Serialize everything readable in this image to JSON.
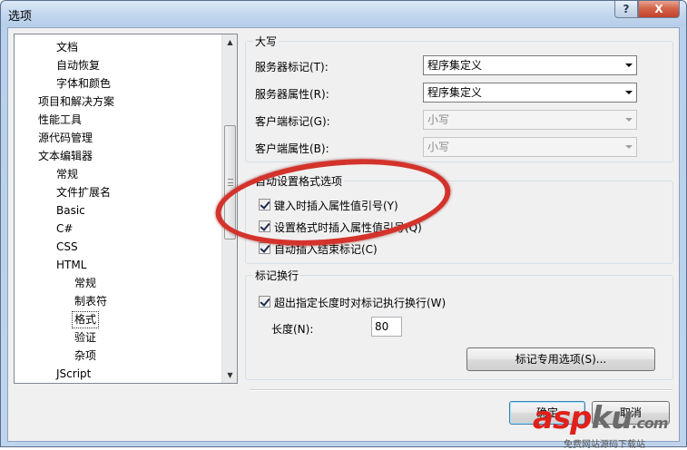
{
  "window": {
    "title": "选项",
    "help_label": "?",
    "close_label": "X"
  },
  "tree": {
    "items": [
      {
        "label": "文档",
        "indent": 1
      },
      {
        "label": "自动恢复",
        "indent": 1
      },
      {
        "label": "字体和颜色",
        "indent": 1
      },
      {
        "label": "项目和解决方案",
        "indent": 0
      },
      {
        "label": "性能工具",
        "indent": 0
      },
      {
        "label": "源代码管理",
        "indent": 0
      },
      {
        "label": "文本编辑器",
        "indent": 0
      },
      {
        "label": "常规",
        "indent": 1
      },
      {
        "label": "文件扩展名",
        "indent": 1
      },
      {
        "label": "Basic",
        "indent": 1
      },
      {
        "label": "C#",
        "indent": 1
      },
      {
        "label": "CSS",
        "indent": 1
      },
      {
        "label": "HTML",
        "indent": 1
      },
      {
        "label": "常规",
        "indent": 2
      },
      {
        "label": "制表符",
        "indent": 2
      },
      {
        "label": "格式",
        "indent": 2,
        "selected": true
      },
      {
        "label": "验证",
        "indent": 2
      },
      {
        "label": "杂项",
        "indent": 2
      },
      {
        "label": "JScript",
        "indent": 1
      }
    ]
  },
  "capitalization": {
    "group_label": "大写",
    "server_tag_label": "服务器标记(T):",
    "server_tag_value": "程序集定义",
    "server_attr_label": "服务器属性(R):",
    "server_attr_value": "程序集定义",
    "client_tag_label": "客户端标记(G):",
    "client_tag_value": "小写",
    "client_attr_label": "客户端属性(B):",
    "client_attr_value": "小写"
  },
  "autoformat": {
    "group_label": "自动设置格式选项",
    "opt1": "键入时插入属性值引号(Y)",
    "opt2": "设置格式时插入属性值引号(Q)",
    "opt3": "自动插入结束标记(C)"
  },
  "wrapping": {
    "group_label": "标记换行",
    "wrap_option": "超出指定长度时对标记执行换行(W)",
    "length_label": "长度(N):",
    "length_value": "80",
    "tag_options_button": "标记专用选项(S)..."
  },
  "footer": {
    "ok_label": "确定",
    "cancel_label": "取消"
  },
  "watermark": {
    "brand_red": "asp",
    "brand_grey": "ku",
    "suffix": ".com",
    "subtitle": "免费网站源码下载站"
  },
  "colors": {
    "annotation": "#d3332b",
    "title_gradient_top": "#dbe8f6",
    "close_button": "#c2412a"
  }
}
